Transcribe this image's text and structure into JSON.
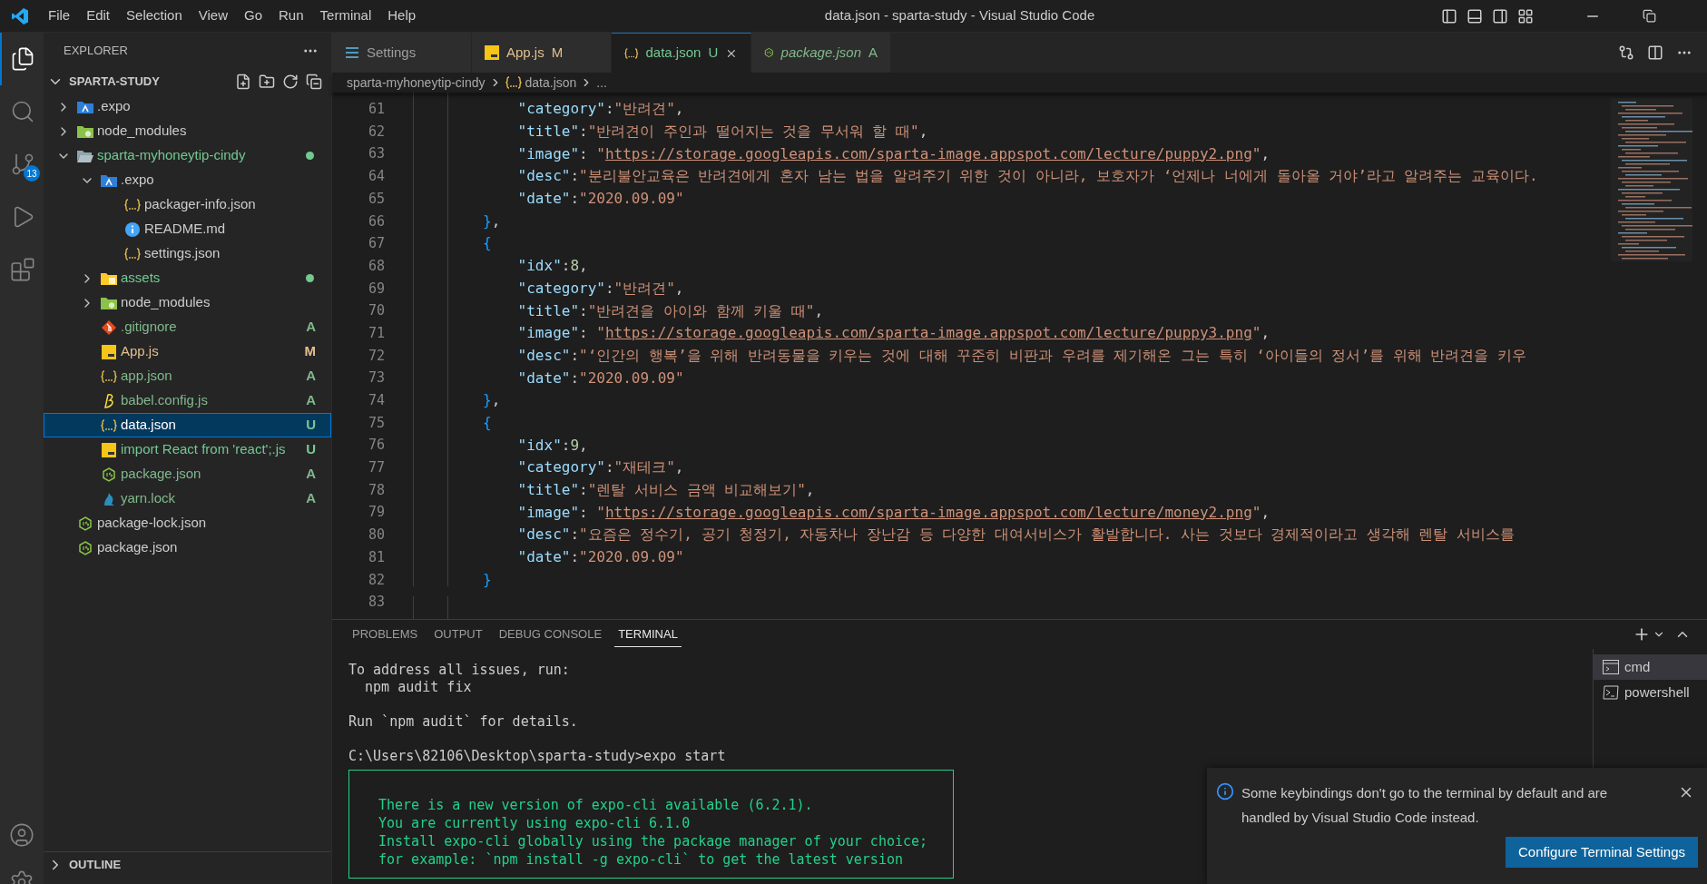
{
  "title_bar": {
    "menu": [
      "File",
      "Edit",
      "Selection",
      "View",
      "Go",
      "Run",
      "Terminal",
      "Help"
    ],
    "title": "data.json - sparta-study - Visual Studio Code"
  },
  "activity_bar": {
    "items": [
      {
        "kind": "explorer",
        "selected": true
      },
      {
        "kind": "search",
        "selected": false
      },
      {
        "kind": "source-control",
        "selected": false,
        "badge": "13"
      },
      {
        "kind": "run",
        "selected": false
      },
      {
        "kind": "extensions",
        "selected": false
      }
    ]
  },
  "sidebar": {
    "title": "EXPLORER",
    "section": {
      "label": "SPARTA-STUDY",
      "expanded": true
    },
    "items": [
      {
        "label": ".expo",
        "kind": "expo-folder",
        "expanded": false,
        "selected": false
      },
      {
        "label": "node_modules",
        "kind": "node-folder",
        "expanded": false,
        "selected": false
      },
      {
        "label": "sparta-myhoneytip-cindy",
        "kind": "open-folder",
        "expanded": true,
        "color": "#73c991",
        "selected": false,
        "children": [
          {
            "label": ".expo",
            "kind": "expo-folder",
            "expanded": true,
            "selected": false,
            "children": [
              {
                "label": "packager-info.json",
                "kind": "json",
                "selected": false
              },
              {
                "label": "README.md",
                "kind": "info",
                "selected": false
              },
              {
                "label": "settings.json",
                "kind": "json",
                "selected": false
              }
            ]
          },
          {
            "label": "assets",
            "kind": "assets-folder",
            "expanded": false,
            "color": "#73c991",
            "selected": false
          },
          {
            "label": "node_modules",
            "kind": "node-folder",
            "expanded": false,
            "selected": false
          },
          {
            "label": ".gitignore",
            "kind": "git",
            "color": "#81b88b",
            "badge": "A",
            "selected": false
          },
          {
            "label": "App.js",
            "kind": "js",
            "color": "#e2c08d",
            "badge": "M",
            "selected": false
          },
          {
            "label": "app.json",
            "kind": "json",
            "color": "#81b88b",
            "badge": "A",
            "selected": false
          },
          {
            "label": "babel.config.js",
            "kind": "babel",
            "color": "#81b88b",
            "badge": "A",
            "selected": false
          },
          {
            "label": "data.json",
            "kind": "json",
            "color": "#73c991",
            "badge": "U",
            "selected": true
          },
          {
            "label": "import React from 'react';.js",
            "kind": "js",
            "color": "#73c991",
            "badge": "U",
            "selected": false
          },
          {
            "label": "package.json",
            "kind": "npm",
            "color": "#81b88b",
            "badge": "A",
            "selected": false
          },
          {
            "label": "yarn.lock",
            "kind": "yarn",
            "color": "#81b88b",
            "badge": "A",
            "selected": false
          }
        ]
      },
      {
        "label": "package-lock.json",
        "kind": "npm",
        "selected": false
      },
      {
        "label": "package.json",
        "kind": "npm",
        "selected": false
      }
    ],
    "outline": {
      "label": "OUTLINE",
      "expanded": false
    }
  },
  "tabs": [
    {
      "label": "Settings",
      "kind": "settings",
      "selected": false,
      "preview": false
    },
    {
      "label": "App.js",
      "kind": "js",
      "color": "#e2c08d",
      "badge": "M",
      "selected": false,
      "preview": false
    },
    {
      "label": "data.json",
      "kind": "json",
      "color": "#73c991",
      "badge": "U",
      "selected": true,
      "preview": false
    },
    {
      "label": "package.json",
      "kind": "npm",
      "color": "#81b88b",
      "badge": "A",
      "selected": false,
      "preview": true
    }
  ],
  "breadcrumb": [
    "sparta-myhoneytip-cindy",
    "data.json",
    "..."
  ],
  "code": [
    {
      "number": "61",
      "tokens": [
        {
          "kind": "key",
          "text": "            \"category\""
        },
        {
          "kind": "punct",
          "text": ":"
        },
        {
          "kind": "string",
          "text": "\"반려견\""
        },
        {
          "kind": "punct",
          "text": ","
        }
      ]
    },
    {
      "number": "62",
      "tokens": [
        {
          "kind": "key",
          "text": "            \"title\""
        },
        {
          "kind": "punct",
          "text": ":"
        },
        {
          "kind": "string",
          "text": "\"반려견이 주인과 떨어지는 것을 무서워 할 때\""
        },
        {
          "kind": "punct",
          "text": ","
        }
      ]
    },
    {
      "number": "63",
      "tokens": [
        {
          "kind": "key",
          "text": "            \"image\""
        },
        {
          "kind": "punct",
          "text": ": "
        },
        {
          "kind": "string",
          "text": "\""
        },
        {
          "kind": "link",
          "text": "https://storage.googleapis.com/sparta-image.appspot.com/lecture/puppy2.png"
        },
        {
          "kind": "string",
          "text": "\""
        },
        {
          "kind": "punct",
          "text": ","
        }
      ]
    },
    {
      "number": "64",
      "tokens": [
        {
          "kind": "key",
          "text": "            \"desc\""
        },
        {
          "kind": "punct",
          "text": ":"
        },
        {
          "kind": "string",
          "text": "\"분리불안교육은 반려견에게 혼자 남는 법을 알려주기 위한 것이 아니라, 보호자가 ‘언제나 너에게 돌아올 거야’라고 알려주는 교육이다."
        }
      ]
    },
    {
      "number": "65",
      "tokens": [
        {
          "kind": "key",
          "text": "            \"date\""
        },
        {
          "kind": "punct",
          "text": ":"
        },
        {
          "kind": "string",
          "text": "\"2020.09.09\""
        }
      ]
    },
    {
      "number": "66",
      "tokens": [
        {
          "kind": "brace",
          "text": "        }"
        },
        {
          "kind": "punct",
          "text": ","
        }
      ]
    },
    {
      "number": "67",
      "tokens": [
        {
          "kind": "brace",
          "text": "        {"
        }
      ]
    },
    {
      "number": "68",
      "tokens": [
        {
          "kind": "key",
          "text": "            \"idx\""
        },
        {
          "kind": "punct",
          "text": ":"
        },
        {
          "kind": "number",
          "text": "8"
        },
        {
          "kind": "punct",
          "text": ","
        }
      ]
    },
    {
      "number": "69",
      "tokens": [
        {
          "kind": "key",
          "text": "            \"category\""
        },
        {
          "kind": "punct",
          "text": ":"
        },
        {
          "kind": "string",
          "text": "\"반려견\""
        },
        {
          "kind": "punct",
          "text": ","
        }
      ]
    },
    {
      "number": "70",
      "tokens": [
        {
          "kind": "key",
          "text": "            \"title\""
        },
        {
          "kind": "punct",
          "text": ":"
        },
        {
          "kind": "string",
          "text": "\"반려견을 아이와 함께 키울 때\""
        },
        {
          "kind": "punct",
          "text": ","
        }
      ]
    },
    {
      "number": "71",
      "tokens": [
        {
          "kind": "key",
          "text": "            \"image\""
        },
        {
          "kind": "punct",
          "text": ": "
        },
        {
          "kind": "string",
          "text": "\""
        },
        {
          "kind": "link",
          "text": "https://storage.googleapis.com/sparta-image.appspot.com/lecture/puppy3.png"
        },
        {
          "kind": "string",
          "text": "\""
        },
        {
          "kind": "punct",
          "text": ","
        }
      ]
    },
    {
      "number": "72",
      "tokens": [
        {
          "kind": "key",
          "text": "            \"desc\""
        },
        {
          "kind": "punct",
          "text": ":"
        },
        {
          "kind": "string",
          "text": "\"‘인간의 행복’을 위해 반려동물을 키우는 것에 대해 꾸준히 비판과 우려를 제기해온 그는 특히 ‘아이들의 정서’를 위해 반려견을 키우"
        }
      ]
    },
    {
      "number": "73",
      "tokens": [
        {
          "kind": "key",
          "text": "            \"date\""
        },
        {
          "kind": "punct",
          "text": ":"
        },
        {
          "kind": "string",
          "text": "\"2020.09.09\""
        }
      ]
    },
    {
      "number": "74",
      "tokens": [
        {
          "kind": "brace",
          "text": "        }"
        },
        {
          "kind": "punct",
          "text": ","
        }
      ]
    },
    {
      "number": "75",
      "tokens": [
        {
          "kind": "brace",
          "text": "        {"
        }
      ]
    },
    {
      "number": "76",
      "tokens": [
        {
          "kind": "key",
          "text": "            \"idx\""
        },
        {
          "kind": "punct",
          "text": ":"
        },
        {
          "kind": "number",
          "text": "9"
        },
        {
          "kind": "punct",
          "text": ","
        }
      ]
    },
    {
      "number": "77",
      "tokens": [
        {
          "kind": "key",
          "text": "            \"category\""
        },
        {
          "kind": "punct",
          "text": ":"
        },
        {
          "kind": "string",
          "text": "\"재테크\""
        },
        {
          "kind": "punct",
          "text": ","
        }
      ]
    },
    {
      "number": "78",
      "tokens": [
        {
          "kind": "key",
          "text": "            \"title\""
        },
        {
          "kind": "punct",
          "text": ":"
        },
        {
          "kind": "string",
          "text": "\"렌탈 서비스 금액 비교해보기\""
        },
        {
          "kind": "punct",
          "text": ","
        }
      ]
    },
    {
      "number": "79",
      "tokens": [
        {
          "kind": "key",
          "text": "            \"image\""
        },
        {
          "kind": "punct",
          "text": ": "
        },
        {
          "kind": "string",
          "text": "\""
        },
        {
          "kind": "link",
          "text": "https://storage.googleapis.com/sparta-image.appspot.com/lecture/money2.png"
        },
        {
          "kind": "string",
          "text": "\""
        },
        {
          "kind": "punct",
          "text": ","
        }
      ]
    },
    {
      "number": "80",
      "tokens": [
        {
          "kind": "key",
          "text": "            \"desc\""
        },
        {
          "kind": "punct",
          "text": ":"
        },
        {
          "kind": "string",
          "text": "\"요즘은 정수기, 공기 청정기, 자동차나 장난감 등 다양한 대여서비스가 활발합니다. 사는 것보다 경제적이라고 생각해 렌탈 서비스를"
        }
      ]
    },
    {
      "number": "81",
      "tokens": [
        {
          "kind": "key",
          "text": "            \"date\""
        },
        {
          "kind": "punct",
          "text": ":"
        },
        {
          "kind": "string",
          "text": "\"2020.09.09\""
        }
      ]
    },
    {
      "number": "82",
      "tokens": [
        {
          "kind": "brace",
          "text": "        }"
        }
      ]
    },
    {
      "number": "83"
    }
  ],
  "panel": {
    "tabs": [
      {
        "label": "PROBLEMS",
        "selected": false
      },
      {
        "label": "OUTPUT",
        "selected": false
      },
      {
        "label": "DEBUG CONSOLE",
        "selected": false
      },
      {
        "label": "TERMINAL",
        "selected": true
      }
    ],
    "terminal": [
      {
        "kind": "text",
        "lines": [
          "To address all issues, run:",
          "  npm audit fix"
        ]
      },
      {
        "kind": "text",
        "lines": [
          "Run `npm audit` for details."
        ]
      },
      {
        "kind": "text",
        "lines": [
          "C:\\Users\\82106\\Desktop\\sparta-study>expo start"
        ]
      },
      {
        "kind": "box",
        "lines": [
          "There is a new version of expo-cli available (6.2.1).",
          "You are currently using expo-cli 6.1.0",
          "Install expo-cli globally using the package manager of your choice;",
          "for example: `npm install -g expo-cli` to get the latest version"
        ]
      }
    ],
    "terminals": [
      {
        "label": "cmd",
        "kind": "cmd",
        "selected": true
      },
      {
        "label": "powershell",
        "kind": "powershell",
        "selected": false
      }
    ]
  },
  "notification": {
    "message": "Some keybindings don't go to the terminal by default and are handled by Visual Studio Code instead.",
    "button": "Configure Terminal Settings"
  }
}
